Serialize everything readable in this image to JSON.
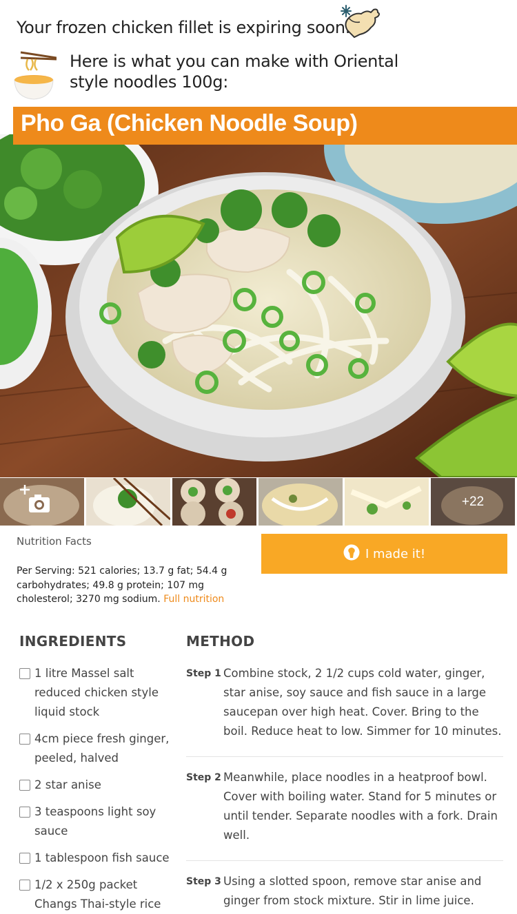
{
  "alert": {
    "expiring_text": "Your frozen chicken fillet is expiring soon.",
    "suggestion_text": "Here is what you can make with Oriental style noodles 100g:",
    "chicken_icon": "frozen-chicken-leg-icon",
    "noodle_icon": "noodle-bowl-icon"
  },
  "recipe": {
    "title": "Pho Ga (Chicken Noodle Soup)",
    "accent_color": "#ee8a1b"
  },
  "gallery": {
    "more_count": "+22",
    "add_photo_icon": "add-photo-camera-icon"
  },
  "nutrition": {
    "heading": "Nutrition Facts",
    "summary": "Per Serving: 521 calories; 13.7 g fat; 54.4 g carbohydrates; 49.8 g protein; 107 mg cholesterol; 3270 mg sodium.",
    "link": "Full nutrition"
  },
  "made_it": {
    "label": "I made it!",
    "color": "#f9a825"
  },
  "ingredients": {
    "heading": "INGREDIENTS",
    "items": [
      "1 litre Massel salt reduced chicken style liquid stock",
      "4cm piece fresh ginger, peeled, halved",
      "2 star anise",
      "3 teaspoons light soy sauce",
      "1 tablespoon fish sauce",
      "1/2 x 250g packet Changs Thai-style rice"
    ]
  },
  "method": {
    "heading": "METHOD",
    "steps": [
      {
        "label": "Step 1",
        "text": "Combine stock, 2 1/2 cups cold water, ginger, star anise, soy sauce and fish sauce in a large saucepan over high heat. Cover. Bring to the boil. Reduce heat to low. Simmer for 10 minutes."
      },
      {
        "label": "Step 2",
        "text": "Meanwhile, place noodles in a heatproof bowl. Cover with boiling water. Stand for 5 minutes or until tender. Separate noodles with a fork. Drain well."
      },
      {
        "label": "Step 3",
        "text": "Using a slotted spoon, remove star anise and ginger from stock mixture. Stir in lime juice."
      }
    ]
  }
}
